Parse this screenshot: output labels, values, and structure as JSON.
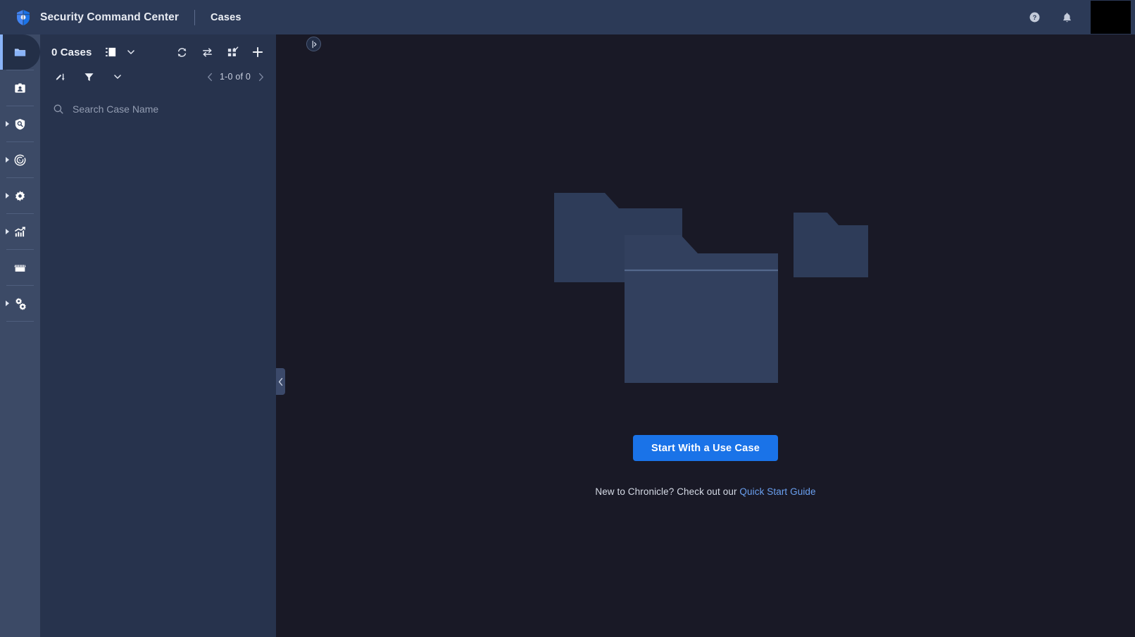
{
  "header": {
    "brand_title": "Security Command Center",
    "page_title": "Cases",
    "help_icon": "help-circle-icon",
    "bell_icon": "notifications-bell-icon",
    "avatar_label": ""
  },
  "sidebar": {
    "items": [
      {
        "label": "Cases",
        "icon": "folder-icon",
        "active": true,
        "expandable": false
      },
      {
        "label": "Entities",
        "icon": "id-badge-icon",
        "active": false,
        "expandable": false
      },
      {
        "label": "Investigation",
        "icon": "shield-search-icon",
        "active": false,
        "expandable": true
      },
      {
        "label": "Detection",
        "icon": "radar-target-icon",
        "active": false,
        "expandable": true
      },
      {
        "label": "Settings",
        "icon": "gear-icon",
        "active": false,
        "expandable": true
      },
      {
        "label": "Reports",
        "icon": "chart-growth-icon",
        "active": false,
        "expandable": true
      },
      {
        "label": "Marketplace",
        "icon": "storefront-icon",
        "active": false,
        "expandable": false
      },
      {
        "label": "Administration",
        "icon": "gears-settings-icon",
        "active": false,
        "expandable": true
      }
    ]
  },
  "cases_panel": {
    "count_label": "0 Cases",
    "view_mode_icon": "list-view-icon",
    "view_mode_caret_icon": "chevron-down-icon",
    "actions": [
      {
        "name": "refresh",
        "icon": "refresh-icon"
      },
      {
        "name": "transfer",
        "icon": "swap-arrows-icon"
      },
      {
        "name": "bulk-select",
        "icon": "grid-select-icon"
      },
      {
        "name": "create-case",
        "icon": "plus-icon"
      }
    ],
    "sort_icon": "sort-icon",
    "filter_icon": "filter-funnel-icon",
    "more_caret_icon": "chevron-down-icon",
    "pagination": {
      "prev_icon": "chevron-left-icon",
      "range_label": "1-0 of 0",
      "next_icon": "chevron-right-icon"
    },
    "search": {
      "icon": "search-icon",
      "placeholder": "Search Case Name",
      "value": ""
    },
    "expand_handle_icon": "panel-expand-icon",
    "collapse_handle_icon": "chevron-left-icon"
  },
  "empty_state": {
    "illustration": "three-folders-illustration",
    "cta_label": "Start With a Use Case",
    "helper_prefix": "New to Chronicle? Check out our ",
    "helper_link": "Quick Start Guide"
  },
  "colors": {
    "header_bg": "#2c3a57",
    "rail_bg": "#3c4a66",
    "panel_bg": "#27334d",
    "main_bg": "#191926",
    "accent_blue": "#1a73e8",
    "active_icon": "#a8c7fa",
    "link_blue": "#6aa0f0",
    "folder_art": "#2f3e5c"
  }
}
